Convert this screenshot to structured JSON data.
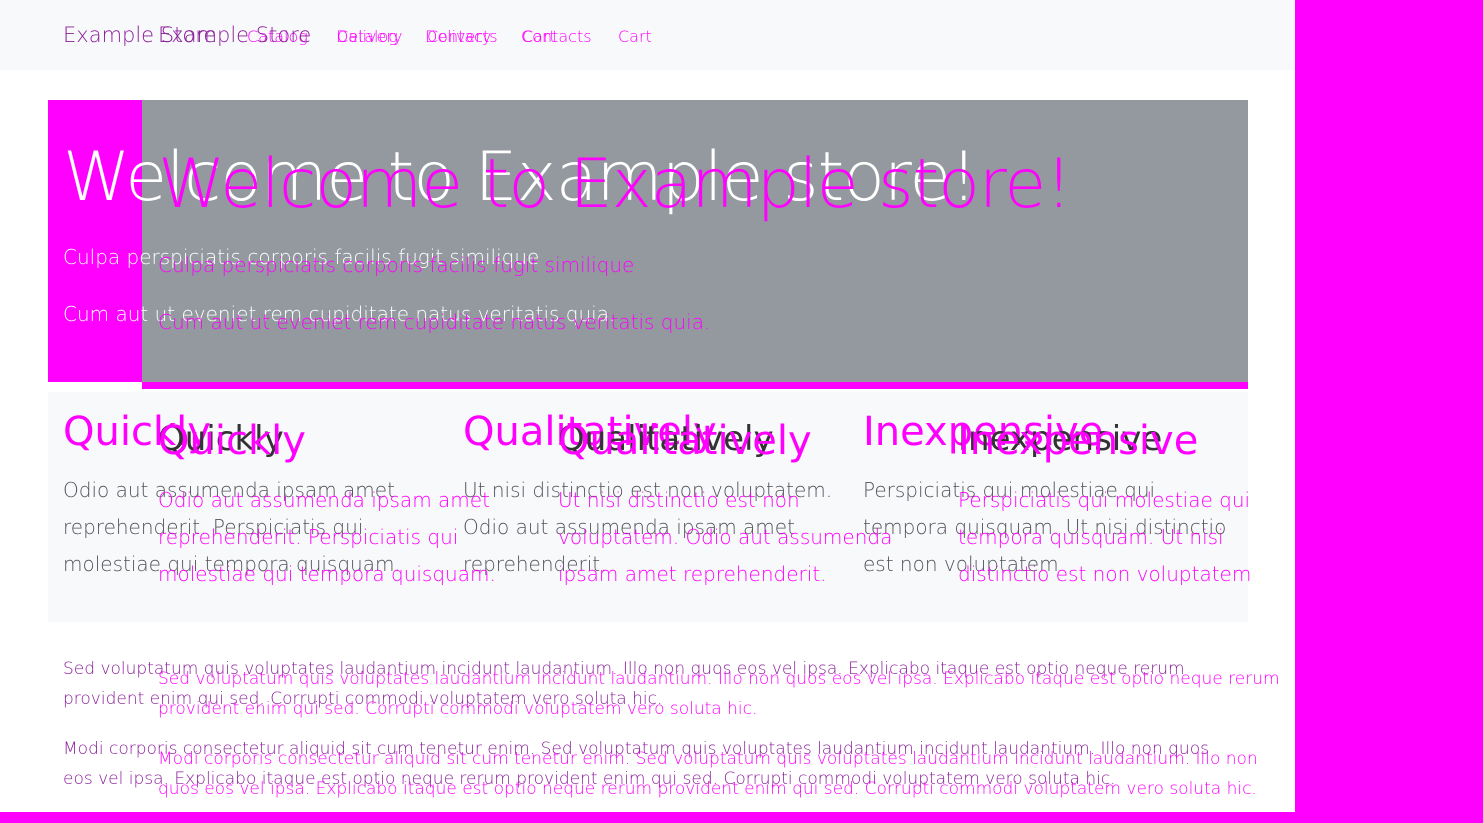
{
  "navbar": {
    "brand": "Example Store",
    "links": [
      "Catalog",
      "Delivery",
      "Contacts",
      "Cart"
    ]
  },
  "hero": {
    "title": "Welcome to Example store!",
    "line1": "Culpa perspiciatis corporis facilis fugit similique",
    "line2": "Cum aut ut eveniet rem cupiditate natus veritatis quia."
  },
  "features": [
    {
      "title": "Quickly",
      "text": "Odio aut assumenda ipsam amet reprehenderit. Perspiciatis qui molestiae qui tempora quisquam."
    },
    {
      "title": "Qualitatively",
      "text": "Ut nisi distinctio est non voluptatem. Odio aut assumenda ipsam amet reprehenderit."
    },
    {
      "title": "Inexpensive",
      "text": "Perspiciatis qui molestiae qui tempora quisquam. Ut nisi distinctio est non voluptatem"
    }
  ],
  "paragraphs": [
    "Sed voluptatum quis voluptates laudantium incidunt laudantium. Illo non quos eos vel ipsa. Explicabo itaque est optio neque rerum provident enim qui sed. Corrupti commodi voluptatem vero soluta hic.",
    "Modi corporis consectetur aliquid sit cum tenetur enim. Sed voluptatum quis voluptates laudantium incidunt laudantium. Illo non quos eos vel ipsa. Explicabo itaque est optio neque rerum provident enim qui sed. Corrupti commodi voluptatem vero soluta hic."
  ],
  "colors": {
    "magenta": "#ff00ff",
    "hero_gray": "#93999f",
    "navbar_bg": "#f8f9fa"
  }
}
